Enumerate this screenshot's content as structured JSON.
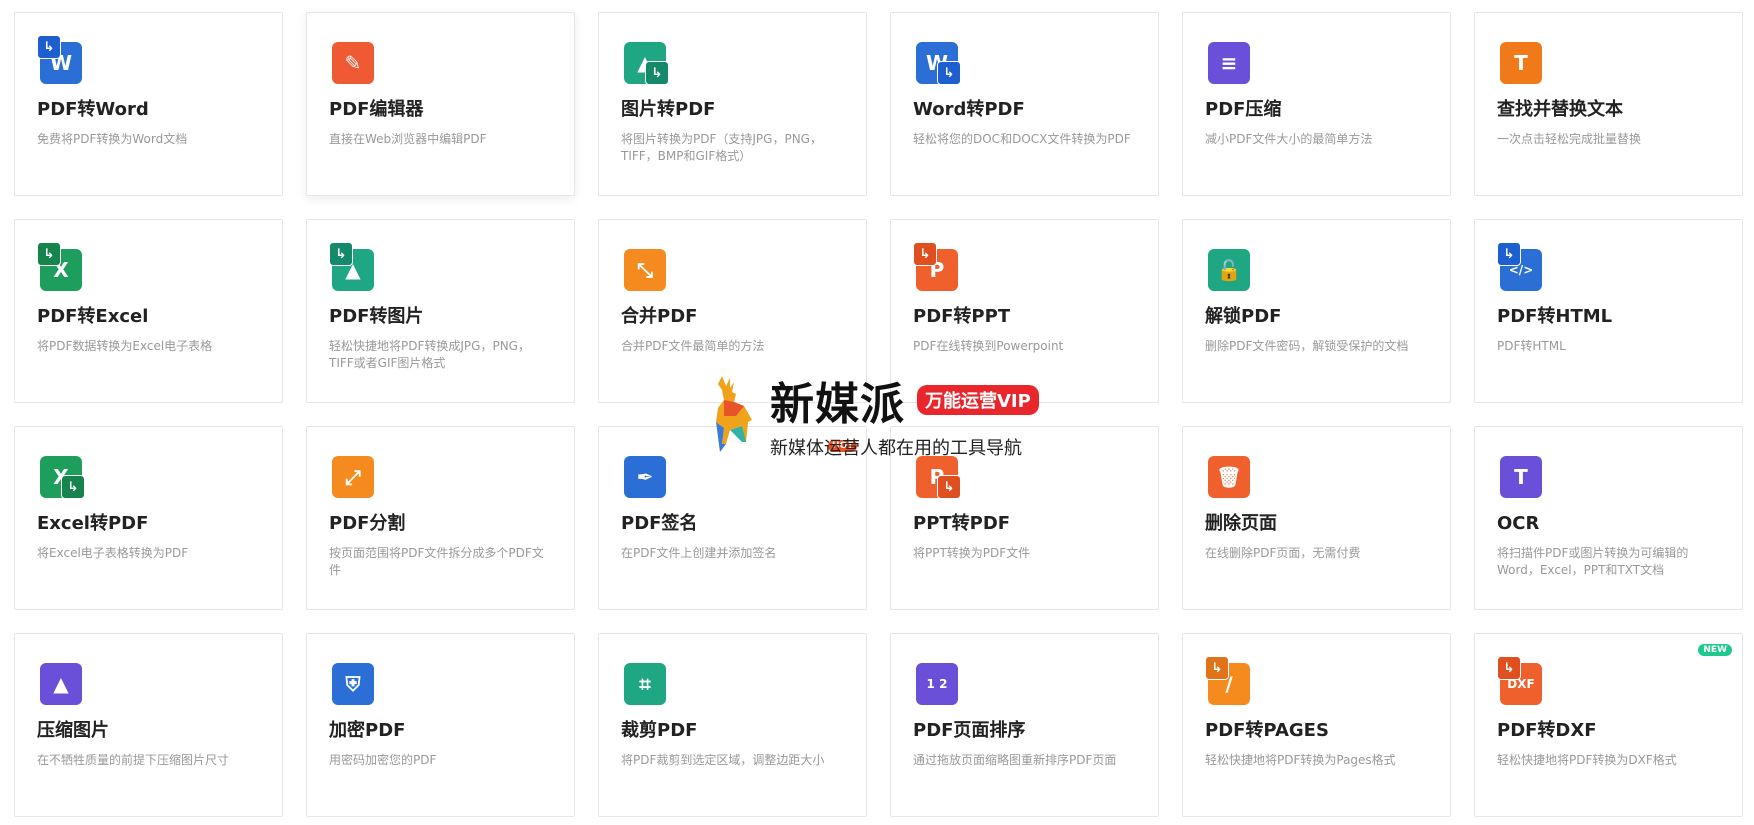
{
  "tools": [
    {
      "title": "PDF转Word",
      "desc": "免费将PDF转换为Word文档",
      "icon": "pdf-to-word-icon",
      "glyph": "W",
      "color": "#2b6fd6",
      "tag": "↳",
      "tagColor": "#1e5fd0",
      "tagPos": "tl"
    },
    {
      "title": "PDF编辑器",
      "desc": "直接在Web浏览器中编辑PDF",
      "icon": "pdf-editor-icon",
      "glyph": "✎",
      "color": "#ef5a35",
      "tag": "",
      "tagColor": "#ef5a35",
      "tagPos": "tl"
    },
    {
      "title": "图片转PDF",
      "desc": "将图片转换为PDF（支持JPG，PNG，TIFF，BMP和GIF格式）",
      "icon": "image-to-pdf-icon",
      "glyph": "▲",
      "color": "#1fa783",
      "tag": "↳",
      "tagColor": "#158a6b",
      "tagPos": "br"
    },
    {
      "title": "Word转PDF",
      "desc": "轻松将您的DOC和DOCX文件转换为PDF",
      "icon": "word-to-pdf-icon",
      "glyph": "W",
      "color": "#2b6fd6",
      "tag": "↳",
      "tagColor": "#1e5fd0",
      "tagPos": "br"
    },
    {
      "title": "PDF压缩",
      "desc": "减小PDF文件大小的最简单方法",
      "icon": "compress-pdf-icon",
      "glyph": "≡",
      "color": "#6a4fd8",
      "tag": "",
      "tagColor": "#6a4fd8",
      "tagPos": "tl"
    },
    {
      "title": "查找并替换文本",
      "desc": "一次点击轻松完成批量替换",
      "icon": "find-replace-icon",
      "glyph": "T",
      "color": "#f07a1a",
      "tag": "",
      "tagColor": "#f07a1a",
      "tagPos": "tl"
    },
    {
      "title": "PDF转Excel",
      "desc": "将PDF数据转换为Excel电子表格",
      "icon": "pdf-to-excel-icon",
      "glyph": "X",
      "color": "#1e9e5c",
      "tag": "↳",
      "tagColor": "#16844c",
      "tagPos": "tl"
    },
    {
      "title": "PDF转图片",
      "desc": "轻松快捷地将PDF转换成JPG，PNG，TIFF或者GIF图片格式",
      "icon": "pdf-to-image-icon",
      "glyph": "▲",
      "color": "#1fa783",
      "tag": "↳",
      "tagColor": "#158a6b",
      "tagPos": "tl"
    },
    {
      "title": "合并PDF",
      "desc": "合并PDF文件最简单的方法",
      "icon": "merge-pdf-icon",
      "glyph": "⤡",
      "color": "#f58a1f",
      "tag": "",
      "tagColor": "#f58a1f",
      "tagPos": "tl"
    },
    {
      "title": "PDF转PPT",
      "desc": "PDF在线转换到Powerpoint",
      "icon": "pdf-to-ppt-icon",
      "glyph": "P",
      "color": "#f0602d",
      "tag": "↳",
      "tagColor": "#e04f1f",
      "tagPos": "tl"
    },
    {
      "title": "解锁PDF",
      "desc": "删除PDF文件密码，解锁受保护的文档",
      "icon": "unlock-pdf-icon",
      "glyph": "🔓",
      "color": "#1fa783",
      "tag": "",
      "tagColor": "#1fa783",
      "tagPos": "tl"
    },
    {
      "title": "PDF转HTML",
      "desc": "PDF转HTML",
      "icon": "pdf-to-html-icon",
      "glyph": "</>",
      "color": "#2b6fd6",
      "tag": "↳",
      "tagColor": "#1e5fd0",
      "tagPos": "tl"
    },
    {
      "title": "Excel转PDF",
      "desc": "将Excel电子表格转换为PDF",
      "icon": "excel-to-pdf-icon",
      "glyph": "X",
      "color": "#1e9e5c",
      "tag": "↳",
      "tagColor": "#16844c",
      "tagPos": "br"
    },
    {
      "title": "PDF分割",
      "desc": "按页面范围将PDF文件拆分成多个PDF文件",
      "icon": "split-pdf-icon",
      "glyph": "⤢",
      "color": "#f58a1f",
      "tag": "",
      "tagColor": "#f58a1f",
      "tagPos": "tl"
    },
    {
      "title": "PDF签名",
      "desc": "在PDF文件上创建并添加签名",
      "icon": "sign-pdf-icon",
      "glyph": "✒",
      "color": "#2b6fd6",
      "tag": "",
      "tagColor": "#2b6fd6",
      "tagPos": "tl"
    },
    {
      "title": "PPT转PDF",
      "desc": "将PPT转换为PDF文件",
      "icon": "ppt-to-pdf-icon",
      "glyph": "P",
      "color": "#f0602d",
      "tag": "↳",
      "tagColor": "#e04f1f",
      "tagPos": "br"
    },
    {
      "title": "删除页面",
      "desc": "在线删除PDF页面，无需付费",
      "icon": "delete-pages-icon",
      "glyph": "🗑",
      "color": "#f0602d",
      "tag": "",
      "tagColor": "#f0602d",
      "tagPos": "tl"
    },
    {
      "title": "OCR",
      "desc": "将扫描件PDF或图片转换为可编辑的Word，Excel，PPT和TXT文档",
      "icon": "ocr-icon",
      "glyph": "T",
      "color": "#6a4fd8",
      "tag": "",
      "tagColor": "#6a4fd8",
      "tagPos": "tl"
    },
    {
      "title": "压缩图片",
      "desc": "在不牺牲质量的前提下压缩图片尺寸",
      "icon": "compress-image-icon",
      "glyph": "▲",
      "color": "#6a4fd8",
      "tag": "",
      "tagColor": "#6a4fd8",
      "tagPos": "tl"
    },
    {
      "title": "加密PDF",
      "desc": "用密码加密您的PDF",
      "icon": "encrypt-pdf-icon",
      "glyph": "⛨",
      "color": "#2b6fd6",
      "tag": "",
      "tagColor": "#2b6fd6",
      "tagPos": "tl"
    },
    {
      "title": "裁剪PDF",
      "desc": "将PDF裁剪到选定区域，调整边距大小",
      "icon": "crop-pdf-icon",
      "glyph": "⌗",
      "color": "#1fa783",
      "tag": "",
      "tagColor": "#1fa783",
      "tagPos": "tl"
    },
    {
      "title": "PDF页面排序",
      "desc": "通过拖放页面缩略图重新排序PDF页面",
      "icon": "reorder-pages-icon",
      "glyph": "1 2",
      "color": "#6a4fd8",
      "tag": "",
      "tagColor": "#6a4fd8",
      "tagPos": "tl"
    },
    {
      "title": "PDF转PAGES",
      "desc": "轻松快捷地将PDF转换为Pages格式",
      "icon": "pdf-to-pages-icon",
      "glyph": "∕",
      "color": "#f58a1f",
      "tag": "↳",
      "tagColor": "#e0731a",
      "tagPos": "tl"
    },
    {
      "title": "PDF转DXF",
      "desc": "轻松快捷地将PDF转换为DXF格式",
      "icon": "pdf-to-dxf-icon",
      "glyph": "DXF",
      "color": "#f0602d",
      "tag": "↳",
      "tagColor": "#e04f1f",
      "tagPos": "tl",
      "badge": "NEW"
    }
  ],
  "watermark": {
    "brand": "新媒派",
    "vip": "万能运营VIP",
    "slogan": "新媒体运营人都在用的工具导航"
  },
  "hot_badge": "HOT"
}
